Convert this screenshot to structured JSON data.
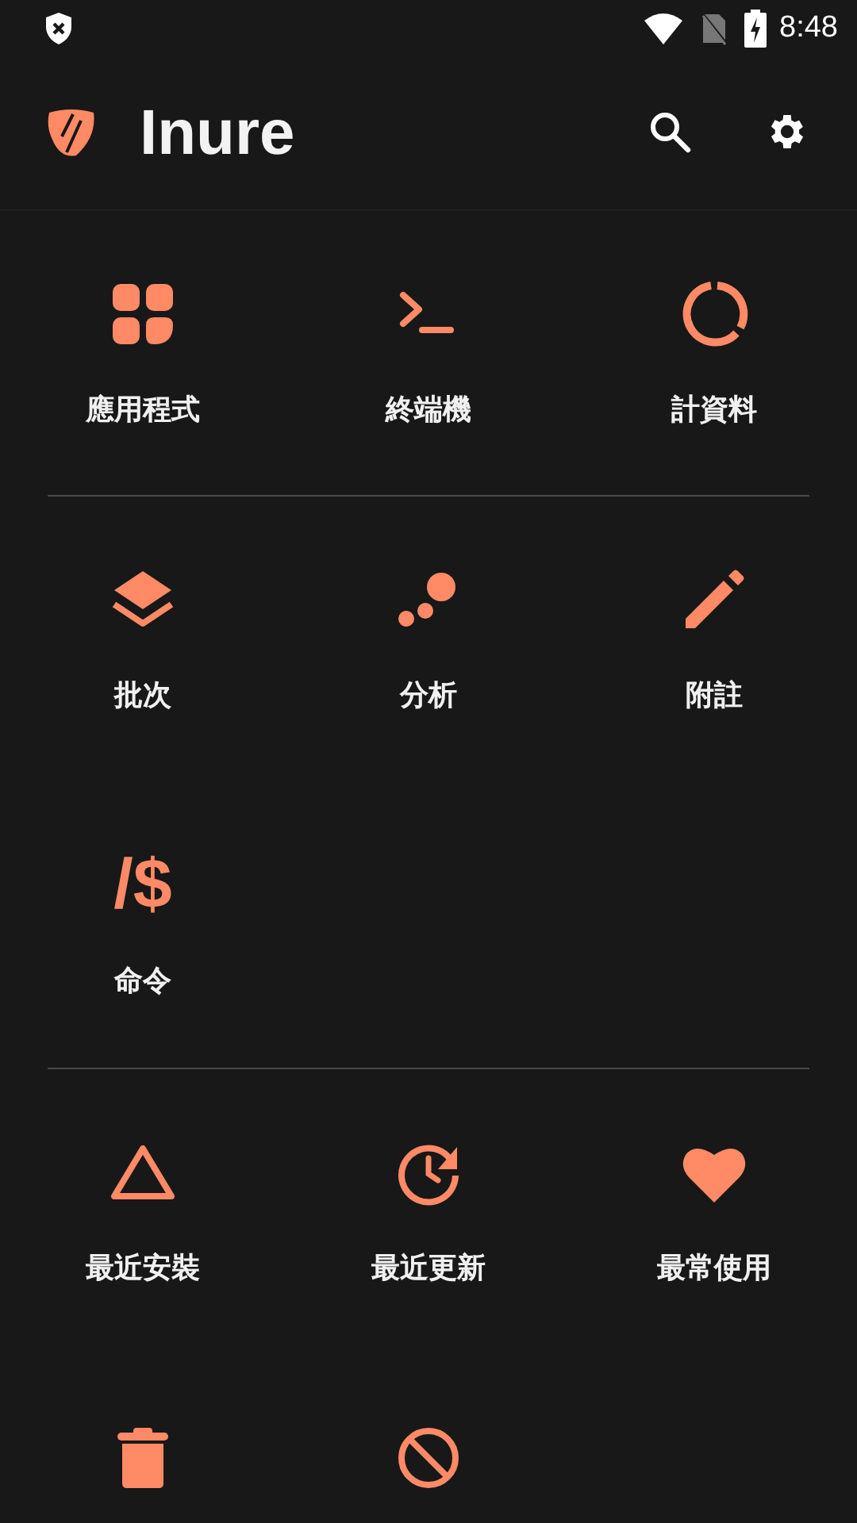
{
  "status_bar": {
    "time": "8:48"
  },
  "app_bar": {
    "title": "Inure"
  },
  "sections": [
    [
      {
        "kind": "tile",
        "label": "應用程式"
      },
      {
        "kind": "tile",
        "label": "終端機"
      },
      {
        "kind": "tile",
        "label": "計資料"
      }
    ],
    [
      {
        "kind": "tile",
        "label": "批次"
      },
      {
        "kind": "tile",
        "label": "分析"
      },
      {
        "kind": "tile",
        "label": "附註"
      },
      {
        "kind": "tile",
        "label": "命令",
        "glyph": "/$"
      }
    ],
    [
      {
        "kind": "tile",
        "label": "最近安裝"
      },
      {
        "kind": "tile",
        "label": "最近更新"
      },
      {
        "kind": "tile",
        "label": "最常使用"
      },
      {
        "kind": "tile"
      },
      {
        "kind": "tile"
      }
    ]
  ]
}
